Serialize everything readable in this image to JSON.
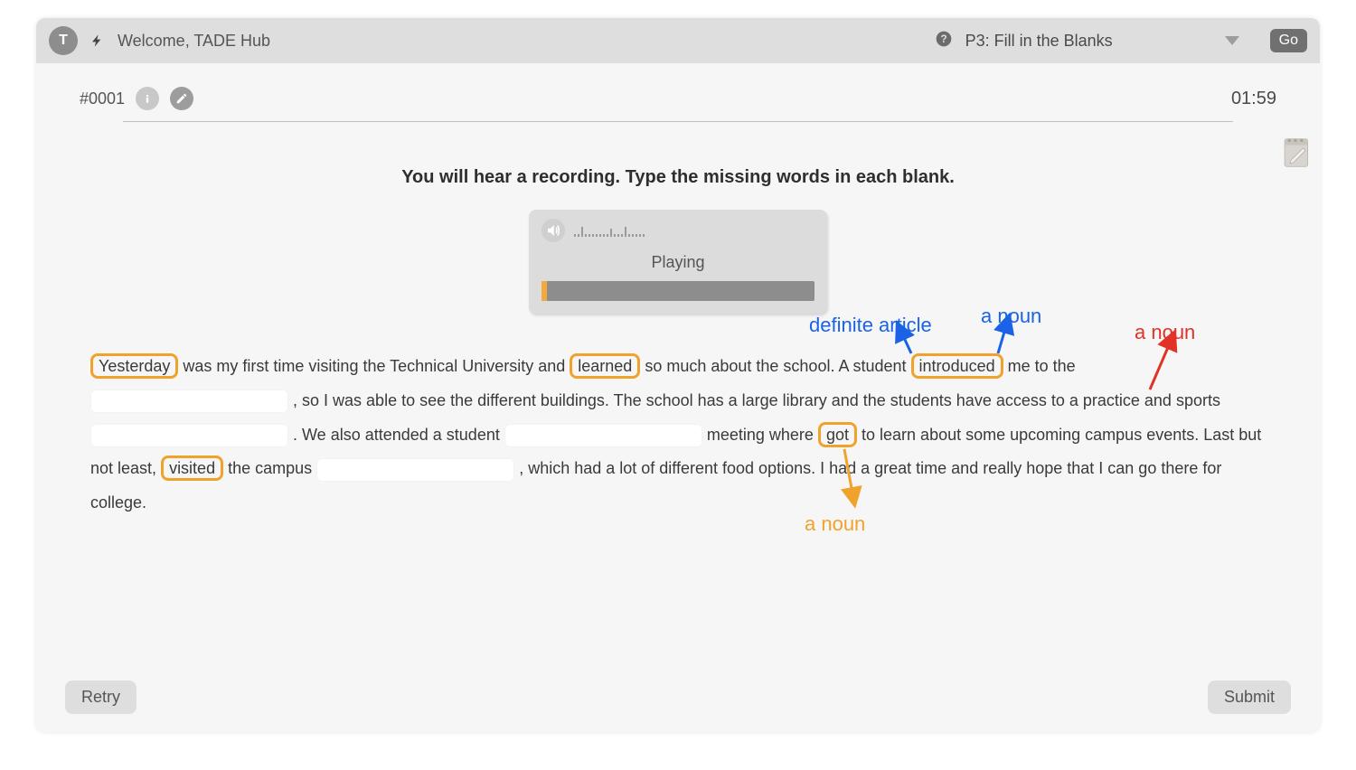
{
  "header": {
    "avatar_letter": "T",
    "welcome": "Welcome, TADE Hub",
    "exercise_label": "P3: Fill in the Blanks",
    "go_label": "Go"
  },
  "sub": {
    "question_id": "#0001",
    "timer": "01:59"
  },
  "instruction": "You will hear a recording. Type the missing words in each blank.",
  "player": {
    "status": "Playing"
  },
  "paragraph": {
    "s1a": "Yesterday",
    "s1b": "was my first time visiting the Technical University and",
    "s1c": "learned",
    "s1d": "so much about the school. A student",
    "s1e": "introduced",
    "s1f": "me to the",
    "s1g": ", so I was able to see the different buildings. The school has a large library and the students have access to a practice and sports",
    "s1h": ". We also attended a student",
    "s1i": "meeting where",
    "s1j": "got",
    "s1k": "to learn about some upcoming campus events. Last but not least,",
    "s1l": "visited",
    "s1m": "the campus",
    "s1n": ", which had a lot of different food options. I had a great time and really hope that I can go there for college."
  },
  "annotations": {
    "definite_article": "definite article",
    "a_noun_blue": "a noun",
    "a_noun_red": "a noun",
    "a_noun_orange": "a noun"
  },
  "buttons": {
    "retry": "Retry",
    "submit": "Submit"
  },
  "colors": {
    "highlight": "#f0a22b",
    "blue": "#1a63e6",
    "red": "#e23227"
  }
}
